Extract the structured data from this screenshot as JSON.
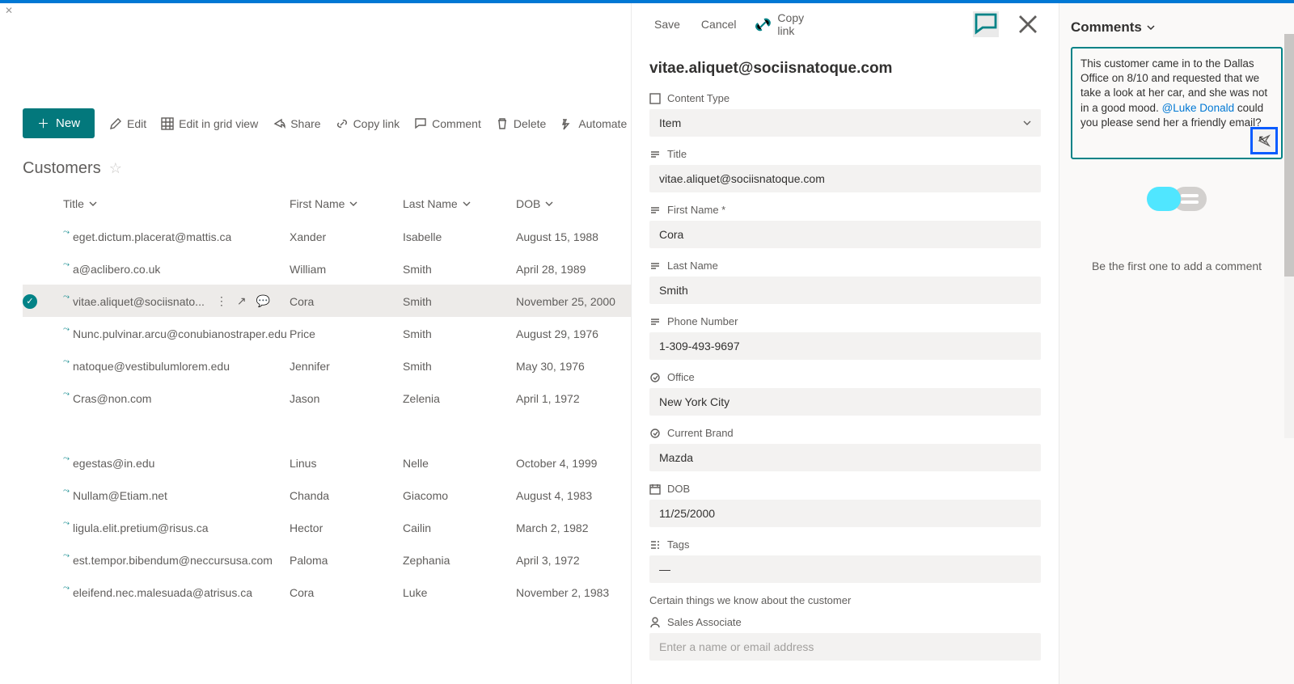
{
  "commands": {
    "new": "New",
    "edit": "Edit",
    "grid": "Edit in grid view",
    "share": "Share",
    "copylink": "Copy link",
    "comment": "Comment",
    "delete": "Delete",
    "automate": "Automate"
  },
  "list": {
    "title": "Customers",
    "columns": {
      "title": "Title",
      "first": "First Name",
      "last": "Last Name",
      "dob": "DOB"
    }
  },
  "rows": [
    {
      "title": "eget.dictum.placerat@mattis.ca",
      "first": "Xander",
      "last": "Isabelle",
      "dob": "August 15, 1988"
    },
    {
      "title": "a@aclibero.co.uk",
      "first": "William",
      "last": "Smith",
      "dob": "April 28, 1989"
    },
    {
      "title": "vitae.aliquet@sociisnato...",
      "first": "Cora",
      "last": "Smith",
      "dob": "November 25, 2000",
      "selected": true
    },
    {
      "title": "Nunc.pulvinar.arcu@conubianostraper.edu",
      "first": "Price",
      "last": "Smith",
      "dob": "August 29, 1976"
    },
    {
      "title": "natoque@vestibulumlorem.edu",
      "first": "Jennifer",
      "last": "Smith",
      "dob": "May 30, 1976"
    },
    {
      "title": "Cras@non.com",
      "first": "Jason",
      "last": "Zelenia",
      "dob": "April 1, 1972"
    }
  ],
  "rows2": [
    {
      "title": "egestas@in.edu",
      "first": "Linus",
      "last": "Nelle",
      "dob": "October 4, 1999"
    },
    {
      "title": "Nullam@Etiam.net",
      "first": "Chanda",
      "last": "Giacomo",
      "dob": "August 4, 1983"
    },
    {
      "title": "ligula.elit.pretium@risus.ca",
      "first": "Hector",
      "last": "Cailin",
      "dob": "March 2, 1982"
    },
    {
      "title": "est.tempor.bibendum@neccursusa.com",
      "first": "Paloma",
      "last": "Zephania",
      "dob": "April 3, 1972"
    },
    {
      "title": "eleifend.nec.malesuada@atrisus.ca",
      "first": "Cora",
      "last": "Luke",
      "dob": "November 2, 1983"
    }
  ],
  "panel": {
    "save": "Save",
    "cancel": "Cancel",
    "copylink": "Copy link",
    "heading": "vitae.aliquet@sociisnatoque.com",
    "fields": {
      "content_type_label": "Content Type",
      "content_type_value": "Item",
      "title_label": "Title",
      "title_value": "vitae.aliquet@sociisnatoque.com",
      "first_label": "First Name *",
      "first_value": "Cora",
      "last_label": "Last Name",
      "last_value": "Smith",
      "phone_label": "Phone Number",
      "phone_value": "1-309-493-9697",
      "office_label": "Office",
      "office_value": "New York City",
      "brand_label": "Current Brand",
      "brand_value": "Mazda",
      "dob_label": "DOB",
      "dob_value": "11/25/2000",
      "tags_label": "Tags",
      "tags_value": "—",
      "section": "Certain things we know about the customer",
      "assoc_label": "Sales Associate",
      "assoc_placeholder": "Enter a name or email address"
    }
  },
  "comments": {
    "header": "Comments",
    "text_a": "This customer came in to the Dallas Office on 8/10 and requested that we take a look at her car, and she was not in a good mood. ",
    "mention": "@Luke Donald",
    "text_b": " could you please send her a friendly email?",
    "empty": "Be the first one to add a comment"
  }
}
